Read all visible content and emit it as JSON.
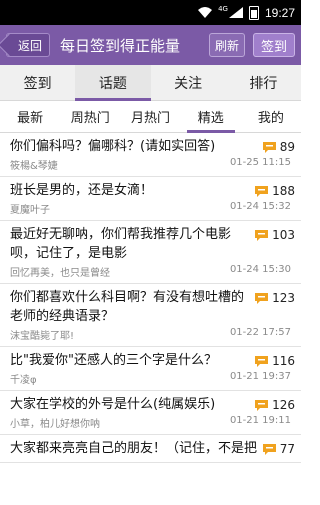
{
  "statusbar": {
    "time": "19:27",
    "signal_tag": "4G"
  },
  "header": {
    "back_label": "返回",
    "title": "每日签到得正能量",
    "refresh_label": "刷新",
    "signin_label": "签到"
  },
  "main_tabs": [
    {
      "label": "签到"
    },
    {
      "label": "话题"
    },
    {
      "label": "关注"
    },
    {
      "label": "排行"
    }
  ],
  "sub_tabs": [
    {
      "label": "最新"
    },
    {
      "label": "周热门"
    },
    {
      "label": "月热门"
    },
    {
      "label": "精选"
    },
    {
      "label": "我的"
    }
  ],
  "topics": [
    {
      "title": "你们偏科吗？偏哪科？(请如实回答)",
      "author": "筱楊&琴婕",
      "time": "01-25 11:15",
      "count": "89"
    },
    {
      "title": "班长是男的，还是女滴！",
      "author": "夏魔叶子",
      "time": "01-24 15:32",
      "count": "188"
    },
    {
      "title": "最近好无聊呐，你们帮我推荐几个电影呗，记住了，是电影",
      "author": "回忆再美，也只是曾经",
      "time": "01-24 15:30",
      "count": "103"
    },
    {
      "title": "你们都喜欢什么科目啊？有没有想吐槽的老师的经典语录？",
      "author": "沫宝酷毙了耶!",
      "time": "01-22 17:57",
      "count": "123"
    },
    {
      "title": "比\"我爱你\"还感人的三个字是什么？",
      "author": "千凌φ",
      "time": "01-21 19:37",
      "count": "116"
    },
    {
      "title": "大家在学校的外号是什么(纯属娱乐)",
      "author": "小草，柏儿好想你呐",
      "time": "01-21 19:11",
      "count": "126"
    },
    {
      "title": "大家都来亮亮自己的朋友！（记住，不是把",
      "author": "",
      "time": "",
      "count": "77"
    }
  ],
  "colors": {
    "accent": "#7b5aa6",
    "comment_icon": "#f0a21e"
  }
}
